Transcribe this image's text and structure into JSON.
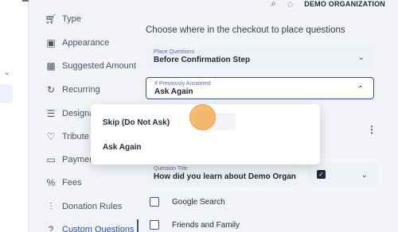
{
  "header": {
    "org_name": "DEMO ORGANIZATION"
  },
  "nav": {
    "items": [
      {
        "label": "Type",
        "icon": "cart-icon"
      },
      {
        "label": "Appearance",
        "icon": "layout-icon"
      },
      {
        "label": "Suggested Amount",
        "icon": "grid-icon"
      },
      {
        "label": "Recurring",
        "icon": "refresh-icon"
      },
      {
        "label": "Designa",
        "icon": "list-icon"
      },
      {
        "label": "Tribute",
        "icon": "heart-icon"
      },
      {
        "label": "Paymen",
        "icon": "card-icon"
      },
      {
        "label": "Fees",
        "icon": "percent-icon"
      },
      {
        "label": "Donation Rules",
        "icon": "rules-icon"
      },
      {
        "label": "Custom Questions",
        "icon": "question-icon"
      }
    ],
    "active": "Custom Questions"
  },
  "main": {
    "heading": "Choose where in the checkout to place questions",
    "place_questions": {
      "label": "Place Questions",
      "value": "Before Confirmation Step"
    },
    "if_previously_answered": {
      "label": "If Previously Answered",
      "value": "Ask Again"
    },
    "question_title": {
      "label": "Question Title",
      "value": "How did you learn about Demo Organ"
    },
    "options": [
      "Google Search",
      "Friends and Family"
    ]
  },
  "dropdown_menu": {
    "items": [
      "Skip (Do Not Ask)",
      "Ask Again"
    ]
  },
  "colors": {
    "accent": "#344ea0",
    "cursor": "#f4a340"
  }
}
